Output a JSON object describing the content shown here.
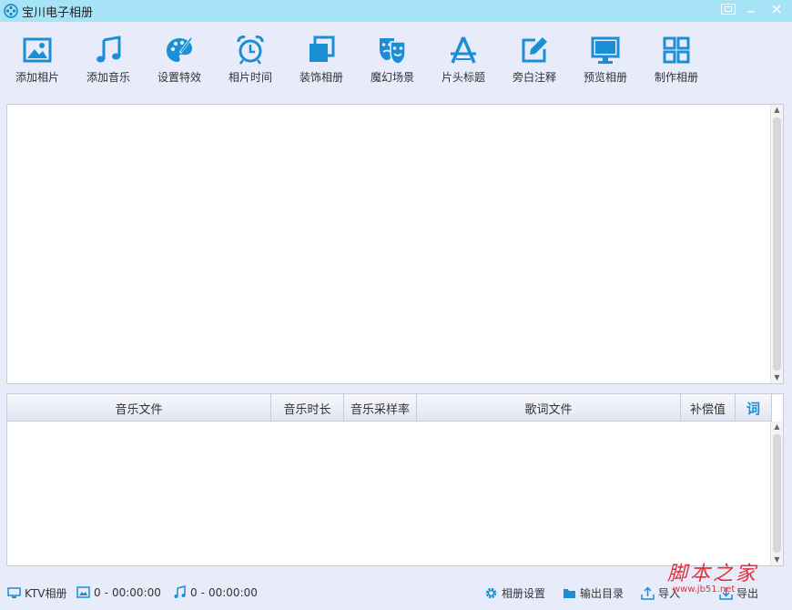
{
  "window": {
    "title": "宝川电子相册"
  },
  "toolbar": {
    "items": [
      {
        "label": "添加相片",
        "icon": "picture-icon"
      },
      {
        "label": "添加音乐",
        "icon": "music-note-icon"
      },
      {
        "label": "设置特效",
        "icon": "palette-icon"
      },
      {
        "label": "相片时间",
        "icon": "alarm-clock-icon"
      },
      {
        "label": "装饰相册",
        "icon": "stacked-squares-icon"
      },
      {
        "label": "魔幻场景",
        "icon": "theater-masks-icon"
      },
      {
        "label": "片头标题",
        "icon": "compass-pencil-icon"
      },
      {
        "label": "旁白注释",
        "icon": "edit-icon"
      },
      {
        "label": "预览相册",
        "icon": "monitor-icon"
      },
      {
        "label": "制作相册",
        "icon": "grid-icon"
      }
    ]
  },
  "music_table": {
    "columns": [
      "音乐文件",
      "音乐时长",
      "音乐采样率",
      "歌词文件",
      "补偿值",
      "词"
    ]
  },
  "statusbar": {
    "ktv_label": "KTV相册",
    "photo_count": "0",
    "photo_sep": "-",
    "photo_time": "00:00:00",
    "music_count": "0",
    "music_sep": "-",
    "music_time": "00:00:00",
    "album_settings": "相册设置",
    "output_dir": "输出目录",
    "import_label": "导入",
    "export_label": "导出"
  },
  "watermark": {
    "main": "脚本之家",
    "sub": "www.jb51.net"
  },
  "colors": {
    "accent": "#1a8fd6",
    "titlebar": "#a7e3f7",
    "background": "#e8ebfa"
  }
}
